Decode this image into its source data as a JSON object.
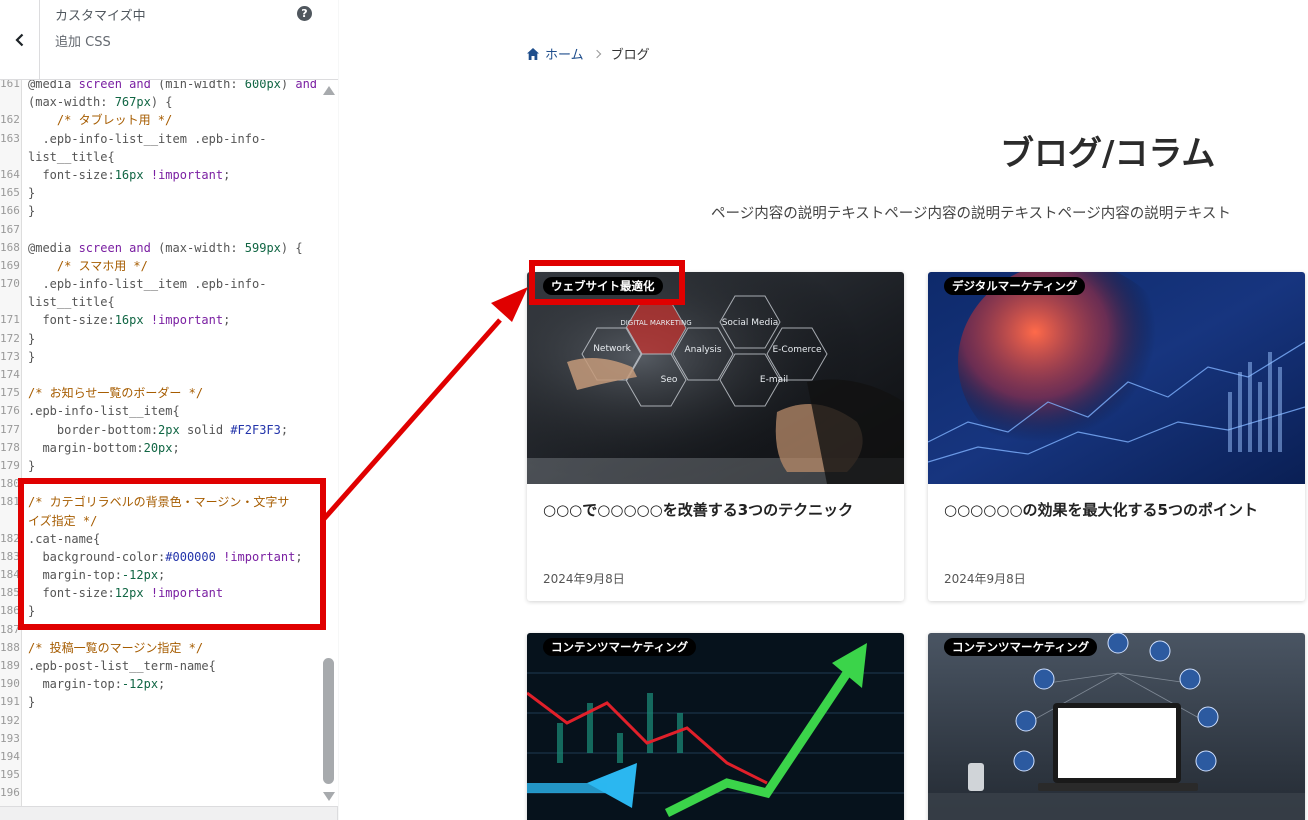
{
  "customizer": {
    "title": "カスタマイズ中",
    "subtitle": "追加 CSS",
    "help_glyph": "?"
  },
  "code_lines": [
    {
      "n": "161",
      "t": "@media screen and (min-width: 600px) and"
    },
    {
      "n": "",
      "t": "(max-width: 767px) {"
    },
    {
      "n": "162",
      "t": "    /* タブレット用 */"
    },
    {
      "n": "163",
      "t": "  .epb-info-list__item .epb-info-"
    },
    {
      "n": "",
      "t": "list__title{"
    },
    {
      "n": "164",
      "t": "  font-size:16px !important;"
    },
    {
      "n": "165",
      "t": "}"
    },
    {
      "n": "166",
      "t": "}"
    },
    {
      "n": "167",
      "t": ""
    },
    {
      "n": "168",
      "t": "@media screen and (max-width: 599px) {"
    },
    {
      "n": "169",
      "t": "    /* スマホ用 */"
    },
    {
      "n": "170",
      "t": "  .epb-info-list__item .epb-info-"
    },
    {
      "n": "",
      "t": "list__title{"
    },
    {
      "n": "171",
      "t": "  font-size:16px !important;"
    },
    {
      "n": "172",
      "t": "}"
    },
    {
      "n": "173",
      "t": "}"
    },
    {
      "n": "174",
      "t": ""
    },
    {
      "n": "175",
      "t": "/* お知らせ一覧のボーダー */"
    },
    {
      "n": "176",
      "t": ".epb-info-list__item{"
    },
    {
      "n": "177",
      "t": "    border-bottom:2px solid #F2F3F3;"
    },
    {
      "n": "178",
      "t": "  margin-bottom:20px;"
    },
    {
      "n": "179",
      "t": "}"
    },
    {
      "n": "180",
      "t": ""
    },
    {
      "n": "181",
      "t": "/* カテゴリラベルの背景色・マージン・文字サ"
    },
    {
      "n": "",
      "t": "イズ指定 */"
    },
    {
      "n": "182",
      "t": ".cat-name{"
    },
    {
      "n": "183",
      "t": "  background-color:#000000 !important;"
    },
    {
      "n": "184",
      "t": "  margin-top:-12px;"
    },
    {
      "n": "185",
      "t": "  font-size:12px !important"
    },
    {
      "n": "186",
      "t": "}"
    },
    {
      "n": "187",
      "t": ""
    },
    {
      "n": "188",
      "t": "/* 投稿一覧のマージン指定 */"
    },
    {
      "n": "189",
      "t": ".epb-post-list__term-name{"
    },
    {
      "n": "190",
      "t": "  margin-top:-12px;"
    },
    {
      "n": "191",
      "t": "}"
    },
    {
      "n": "192",
      "t": ""
    },
    {
      "n": "193",
      "t": ""
    },
    {
      "n": "194",
      "t": ""
    },
    {
      "n": "195",
      "t": ""
    },
    {
      "n": "196",
      "t": ""
    }
  ],
  "breadcrumb": {
    "home": "ホーム",
    "current": "ブログ"
  },
  "page": {
    "title": "ブログ/コラム",
    "description": "ページ内容の説明テキストページ内容の説明テキストページ内容の説明テキスト"
  },
  "cards": [
    {
      "category": "ウェブサイト最適化",
      "title": "○○○で○○○○○を改善する3つのテクニック",
      "date": "2024年9月8日",
      "hex_labels": [
        "DIGITAL MARKETING",
        "Social Media",
        "Network",
        "Analysis",
        "E-Comerce",
        "Seo",
        "E-mail"
      ]
    },
    {
      "category": "デジタルマーケティング",
      "title": "○○○○○○の効果を最大化する5つのポイント",
      "date": "2024年9月8日"
    },
    {
      "category": "コンテンツマーケティング"
    },
    {
      "category": "コンテンツマーケティング"
    }
  ],
  "colors": {
    "accent_annotation": "#e00000",
    "link": "#1f4e8c",
    "label_bg": "#000000"
  },
  "icons": [
    "back-chevron-icon",
    "help-icon",
    "home-icon",
    "chevron-right-icon",
    "scroll-up-arrow-icon",
    "scroll-down-arrow-icon"
  ]
}
